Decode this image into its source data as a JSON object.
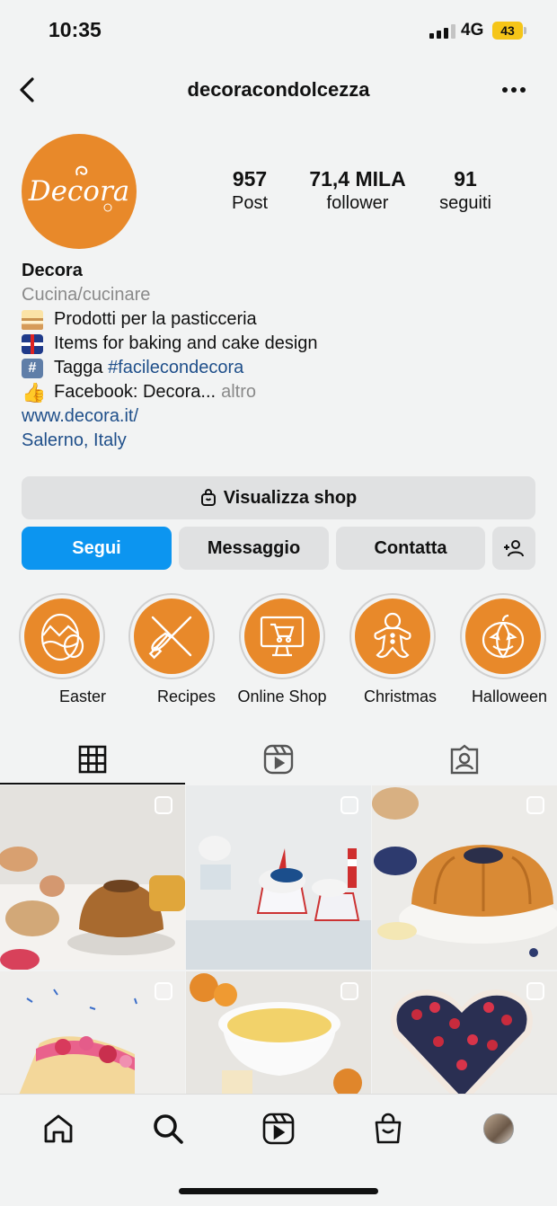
{
  "status_bar": {
    "time": "10:35",
    "network": "4G",
    "battery": "43"
  },
  "header": {
    "username": "decoracondolcezza"
  },
  "profile": {
    "avatar_text": "Decora",
    "stats": [
      {
        "value": "957",
        "label": "Post"
      },
      {
        "value": "71,4 MILA",
        "label": "follower"
      },
      {
        "value": "91",
        "label": "seguiti"
      }
    ],
    "name": "Decora",
    "category": "Cucina/cucinare",
    "bio": {
      "line1": "Prodotti per la pasticceria",
      "line2": "Items for baking and cake design",
      "line3_prefix": "Tagga ",
      "line3_hashtag": "#facilecondecora",
      "line4": "Facebook: Decora...",
      "more": "altro"
    },
    "website": "www.decora.it/",
    "location": "Salerno, Italy"
  },
  "actions": {
    "shop": "Visualizza shop",
    "follow": "Segui",
    "message": "Messaggio",
    "contact": "Contatta"
  },
  "highlights": [
    {
      "label": "Easter",
      "icon": "easter-egg-icon"
    },
    {
      "label": "Recipes",
      "icon": "whisk-rolling-pin-icon"
    },
    {
      "label": "Online Shop",
      "icon": "monitor-cart-icon"
    },
    {
      "label": "Christmas",
      "icon": "gingerbread-man-icon"
    },
    {
      "label": "Halloween",
      "icon": "pumpkin-icon"
    }
  ],
  "tabs": [
    {
      "name": "grid",
      "icon": "grid-icon",
      "active": true
    },
    {
      "name": "reels",
      "icon": "reels-icon",
      "active": false
    },
    {
      "name": "tagged",
      "icon": "tagged-user-icon",
      "active": false
    }
  ],
  "posts": [
    {
      "subject": "bundt-cake-with-eggs-and-raspberries"
    },
    {
      "subject": "nautical-cupcakes"
    },
    {
      "subject": "orange-flower-cake-with-blueberries"
    },
    {
      "subject": "berry-layer-cake"
    },
    {
      "subject": "custard-bowl-with-oranges"
    },
    {
      "subject": "heart-berry-cheesecake"
    }
  ],
  "bottom_nav": [
    {
      "name": "home",
      "icon": "home-icon"
    },
    {
      "name": "search",
      "icon": "search-icon"
    },
    {
      "name": "reels",
      "icon": "reels-icon"
    },
    {
      "name": "shop",
      "icon": "shopping-bag-icon"
    },
    {
      "name": "profile",
      "icon": "profile-avatar"
    }
  ],
  "colors": {
    "brand_orange": "#e8892a",
    "follow_blue": "#0c95f0",
    "link_blue": "#1f4f8a"
  }
}
